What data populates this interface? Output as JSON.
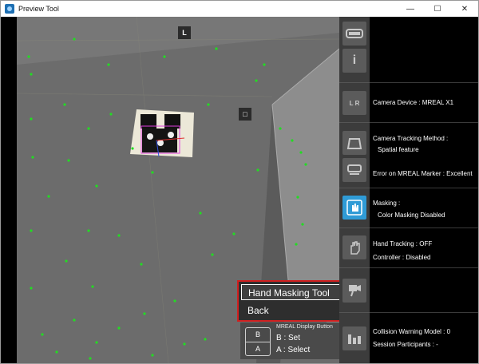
{
  "window": {
    "title": "Preview Tool",
    "controls": {
      "minimize": "—",
      "maximize": "☐",
      "close": "✕"
    }
  },
  "viewport": {
    "markers": {
      "l_marker": "L",
      "square_marker": "□"
    }
  },
  "popup_menu": {
    "items": [
      {
        "label": "Hand Masking Tool",
        "selected": true
      },
      {
        "label": "Back",
        "selected": false
      }
    ],
    "border_color": "#d02020"
  },
  "button_hint": {
    "title": "MREAL Display Button",
    "key_b": "B",
    "key_a": "A",
    "b_action": "B : Set",
    "a_action": "A : Select"
  },
  "side_icons": [
    {
      "name": "hmd-icon"
    },
    {
      "name": "info-icon",
      "glyph": "i"
    },
    {
      "name": "camera-lr-icon",
      "glyph": "L R"
    },
    {
      "name": "tracking-icon"
    },
    {
      "name": "marker-icon"
    },
    {
      "name": "masking-icon",
      "active": true
    },
    {
      "name": "hand-icon"
    },
    {
      "name": "controller-icon"
    },
    {
      "name": "collision-icon"
    }
  ],
  "info_panel": {
    "camera_device": "Camera Device : MREAL X1",
    "tracking_method_label": "Camera Tracking Method :",
    "tracking_method_value": "Spatial feature",
    "marker_error": "Error on MREAL Marker : Excellent",
    "masking_label": "Masking :",
    "masking_value": "Color Masking Disabled",
    "hand_tracking": "Hand Tracking : OFF",
    "controller": "Controller : Disabled",
    "collision_warning": "Collision Warning Model : 0",
    "session_participants": "Session Participants : -"
  },
  "colors": {
    "accent": "#2f9bd6",
    "feature_points": "#22dd22",
    "highlight_border": "#d02020"
  }
}
